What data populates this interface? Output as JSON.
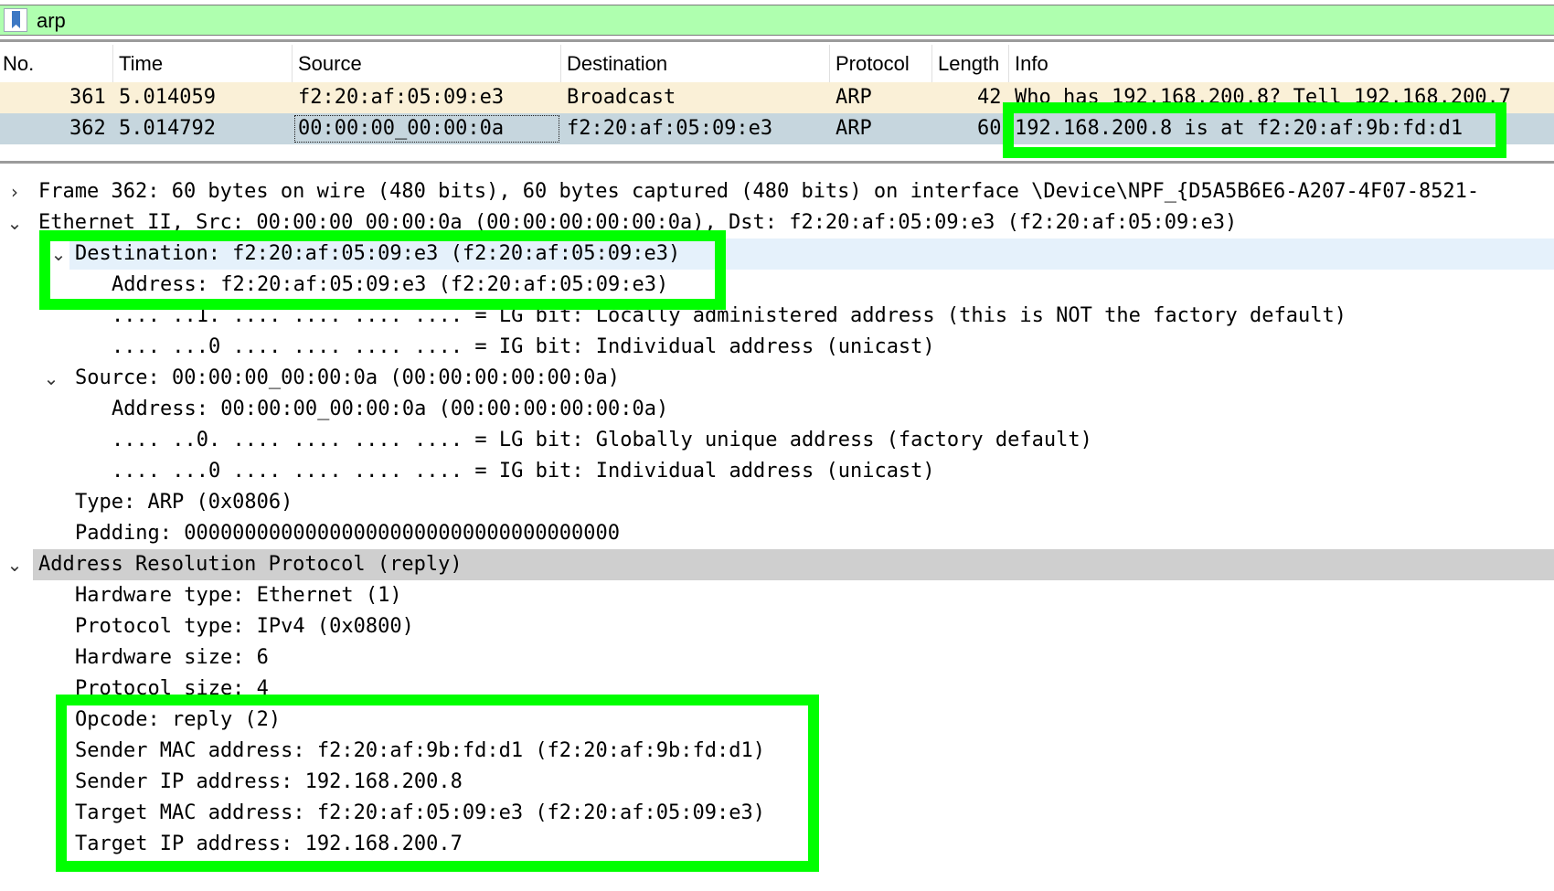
{
  "filter": {
    "value": "arp"
  },
  "columns": [
    "No.",
    "Time",
    "Source",
    "Destination",
    "Protocol",
    "Length",
    "Info"
  ],
  "packets": [
    {
      "no": "361",
      "time": "5.014059",
      "source": "f2:20:af:05:09:e3",
      "destination": "Broadcast",
      "protocol": "ARP",
      "length": "42",
      "info": "Who has 192.168.200.8? Tell 192.168.200.7"
    },
    {
      "no": "362",
      "time": "5.014792",
      "source": "00:00:00_00:00:0a",
      "destination": "f2:20:af:05:09:e3",
      "protocol": "ARP",
      "length": "60",
      "info": "192.168.200.8 is at f2:20:af:9b:fd:d1"
    }
  ],
  "details": {
    "frame": "Frame 362: 60 bytes on wire (480 bits), 60 bytes captured (480 bits) on interface \\Device\\NPF_{D5A5B6E6-A207-4F07-8521-",
    "ethernet": "Ethernet II, Src: 00:00:00_00:00:0a (00:00:00:00:00:0a), Dst: f2:20:af:05:09:e3 (f2:20:af:05:09:e3)",
    "dst": "Destination: f2:20:af:05:09:e3 (f2:20:af:05:09:e3)",
    "dst_address": "Address: f2:20:af:05:09:e3 (f2:20:af:05:09:e3)",
    "dst_lg": ".... ..1. .... .... .... .... = LG bit: Locally administered address (this is NOT the factory default)",
    "dst_ig": ".... ...0 .... .... .... .... = IG bit: Individual address (unicast)",
    "src": "Source: 00:00:00_00:00:0a (00:00:00:00:00:0a)",
    "src_address": "Address: 00:00:00_00:00:0a (00:00:00:00:00:0a)",
    "src_lg": ".... ..0. .... .... .... .... = LG bit: Globally unique address (factory default)",
    "src_ig": ".... ...0 .... .... .... .... = IG bit: Individual address (unicast)",
    "type": "Type: ARP (0x0806)",
    "padding": "Padding: 000000000000000000000000000000000000",
    "arp": "Address Resolution Protocol (reply)",
    "hw_type": "Hardware type: Ethernet (1)",
    "proto_type": "Protocol type: IPv4 (0x0800)",
    "hw_size": "Hardware size: 6",
    "proto_size": "Protocol size: 4",
    "opcode": "Opcode: reply (2)",
    "sender_mac": "Sender MAC address: f2:20:af:9b:fd:d1 (f2:20:af:9b:fd:d1)",
    "sender_ip": "Sender IP address: 192.168.200.8",
    "target_mac": "Target MAC address: f2:20:af:05:09:e3 (f2:20:af:05:09:e3)",
    "target_ip": "Target IP address: 192.168.200.7"
  },
  "icons": {
    "bookmark": "bookmark-icon",
    "collapsed": "chevron-right-icon",
    "expanded": "chevron-down-icon"
  },
  "colors": {
    "filter_valid": "#afffaf",
    "row_arp": "#faf0d7",
    "row_selected": "#c6d6de",
    "annotation": "#00ff00"
  }
}
